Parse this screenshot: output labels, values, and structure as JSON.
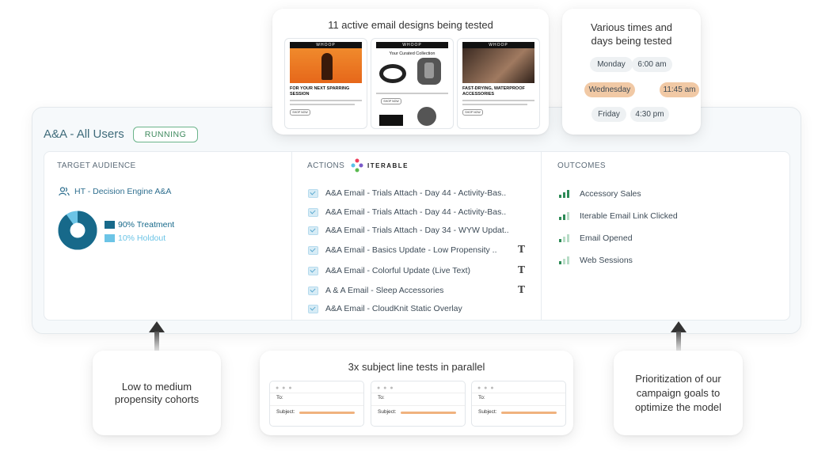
{
  "colors": {
    "accent": "#2f6f8f",
    "running": "#3f8a5e",
    "treatment": "#17698a",
    "holdout": "#6cc4e6",
    "highlight": "#f1c9a5"
  },
  "email_designs": {
    "title": "11 active email designs being tested",
    "thumbs": [
      {
        "brand": "WHOOP",
        "headline": "FOR YOUR NEXT SPARRING SESSION",
        "button": "SHOP NOW"
      },
      {
        "brand": "WHOOP",
        "headline": "Your Curated Collection",
        "button": "SHOP NOW"
      },
      {
        "brand": "WHOOP",
        "headline": "FAST-DRYING, WATERPROOF ACCESSORIES",
        "button": "SHOP NOW"
      }
    ]
  },
  "times": {
    "title_line1": "Various times and",
    "title_line2": "days being tested",
    "rows": [
      {
        "day": "Monday",
        "time": "6:00 am",
        "highlight": false
      },
      {
        "day": "Wednesday",
        "time": "11:45 am",
        "highlight": true
      },
      {
        "day": "Friday",
        "time": "4:30 pm",
        "highlight": false
      }
    ]
  },
  "campaign": {
    "title": "A&A - All Users",
    "status": "RUNNING",
    "audience": {
      "header": "TARGET AUDIENCE",
      "name": "HT - Decision Engine A&A",
      "treatment_label": "90% Treatment",
      "holdout_label": "10% Holdout",
      "treatment_share": 0.9
    },
    "actions": {
      "header": "ACTIONS",
      "logo_text": "ITERABLE",
      "items": [
        {
          "label": "A&A Email - Trials Attach - Day 44 - Activity-Bas..",
          "text_icon": false
        },
        {
          "label": "A&A Email - Trials Attach - Day 44 - Activity-Bas..",
          "text_icon": false
        },
        {
          "label": "A&A Email - Trials Attach - Day 34 - WYW Updat..",
          "text_icon": false
        },
        {
          "label": "A&A Email - Basics Update - Low Propensity ..",
          "text_icon": true
        },
        {
          "label": "A&A Email - Colorful Update (Live Text)",
          "text_icon": true
        },
        {
          "label": "A & A Email - Sleep Accessories",
          "text_icon": true
        },
        {
          "label": "A&A Email - CloudKnit Static Overlay",
          "text_icon": false
        }
      ]
    },
    "outcomes": {
      "header": "OUTCOMES",
      "items": [
        {
          "label": "Accessory Sales",
          "level": 3
        },
        {
          "label": "Iterable Email Link Clicked",
          "level": 2
        },
        {
          "label": "Email Opened",
          "level": 1
        },
        {
          "label": "Web Sessions",
          "level": 1
        }
      ]
    }
  },
  "cohorts": {
    "line1": "Low to medium",
    "line2": "propensity cohorts"
  },
  "subject_tests": {
    "title": "3x subject line tests in parallel",
    "to_label": "To:",
    "subject_label": "Subject:",
    "dots": "● ● ●"
  },
  "prioritization": {
    "line1": "Prioritization of our",
    "line2": "campaign goals to",
    "line3": "optimize the model"
  }
}
